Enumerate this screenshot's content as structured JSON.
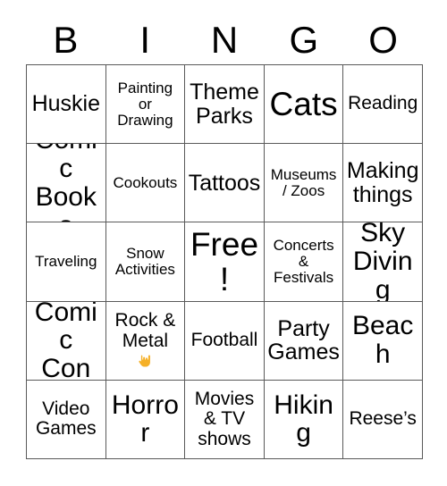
{
  "card": {
    "type": "bingo-card",
    "background_color": "#ffffff",
    "text_color": "#000000",
    "border_color": "#5a5a5a",
    "accent_color": "#F5B027"
  },
  "header": {
    "letters": [
      "B",
      "I",
      "N",
      "G",
      "O"
    ]
  },
  "grid": {
    "columns": 5,
    "rows": 5,
    "cells": [
      {
        "text": "Huskie",
        "size": "l",
        "icon": null
      },
      {
        "text": "Painting\nor\nDrawing",
        "size": "s",
        "icon": null
      },
      {
        "text": "Theme\nParks",
        "size": "l",
        "icon": null
      },
      {
        "text": "Cats",
        "size": "xxl",
        "icon": null
      },
      {
        "text": "Reading",
        "size": "m",
        "icon": null
      },
      {
        "text": "Comic\nBooks",
        "size": "xl",
        "icon": null
      },
      {
        "text": "Cookouts",
        "size": "s",
        "icon": null
      },
      {
        "text": "Tattoos",
        "size": "l",
        "icon": null
      },
      {
        "text": "Museums\n/ Zoos",
        "size": "s",
        "icon": null
      },
      {
        "text": "Making\nthings",
        "size": "l",
        "icon": null
      },
      {
        "text": "Traveling",
        "size": "s",
        "icon": null
      },
      {
        "text": "Snow\nActivities",
        "size": "s",
        "icon": null
      },
      {
        "text": "Free!",
        "size": "xxl",
        "icon": null
      },
      {
        "text": "Concerts\n&\nFestivals",
        "size": "s",
        "icon": null
      },
      {
        "text": "Sky\nDiving",
        "size": "xl",
        "icon": null
      },
      {
        "text": "Comic\nCon",
        "size": "xl",
        "icon": null
      },
      {
        "text": "Rock &\nMetal",
        "size": "m",
        "icon": "sign-of-the-horns-emoji"
      },
      {
        "text": "Football",
        "size": "m",
        "icon": null
      },
      {
        "text": "Party\nGames",
        "size": "l",
        "icon": null
      },
      {
        "text": "Beach",
        "size": "xl",
        "icon": null
      },
      {
        "text": "Video\nGames",
        "size": "m",
        "icon": null
      },
      {
        "text": "Horror",
        "size": "xl",
        "icon": null
      },
      {
        "text": "Movies\n& TV\nshows",
        "size": "m",
        "icon": null
      },
      {
        "text": "Hiking",
        "size": "xl",
        "icon": null
      },
      {
        "text": "Reese’s",
        "size": "m",
        "icon": null
      }
    ]
  }
}
